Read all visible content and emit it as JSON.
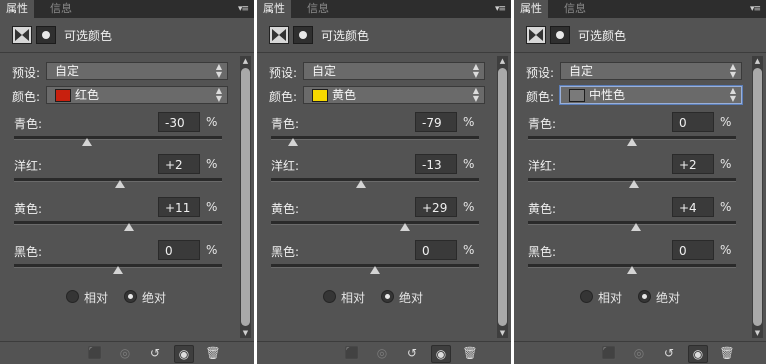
{
  "panels": [
    {
      "tabs": [
        "属性",
        "信息"
      ],
      "title": "可选颜色",
      "preset_label": "预设:",
      "preset_value": "自定",
      "color_label": "颜色:",
      "color_value": "红色",
      "color_swatch": "#c8200e",
      "sliders": [
        {
          "label": "青色:",
          "value": "-30",
          "unit": "%",
          "level": -30
        },
        {
          "label": "洋红:",
          "value": "+2",
          "unit": "%",
          "level": 2
        },
        {
          "label": "黄色:",
          "value": "+11",
          "unit": "%",
          "level": 11
        },
        {
          "label": "黑色:",
          "value": "0",
          "unit": "%",
          "level": 0
        }
      ],
      "radio_relative": "相对",
      "radio_absolute": "绝对",
      "mode_selected": "absolute"
    },
    {
      "tabs": [
        "属性",
        "信息"
      ],
      "title": "可选颜色",
      "preset_label": "预设:",
      "preset_value": "自定",
      "color_label": "颜色:",
      "color_value": "黄色",
      "color_swatch": "#f5d800",
      "sliders": [
        {
          "label": "青色:",
          "value": "-79",
          "unit": "%",
          "level": -79
        },
        {
          "label": "洋红:",
          "value": "-13",
          "unit": "%",
          "level": -13
        },
        {
          "label": "黄色:",
          "value": "+29",
          "unit": "%",
          "level": 29
        },
        {
          "label": "黑色:",
          "value": "0",
          "unit": "%",
          "level": 0
        }
      ],
      "radio_relative": "相对",
      "radio_absolute": "绝对",
      "mode_selected": "absolute"
    },
    {
      "tabs": [
        "属性",
        "信息"
      ],
      "title": "可选颜色",
      "preset_label": "预设:",
      "preset_value": "自定",
      "color_label": "颜色:",
      "color_value": "中性色",
      "color_swatch": "#7a7a7a",
      "sliders": [
        {
          "label": "青色:",
          "value": "0",
          "unit": "%",
          "level": 0
        },
        {
          "label": "洋红:",
          "value": "+2",
          "unit": "%",
          "level": 2
        },
        {
          "label": "黄色:",
          "value": "+4",
          "unit": "%",
          "level": 4
        },
        {
          "label": "黑色:",
          "value": "0",
          "unit": "%",
          "level": 0
        }
      ],
      "radio_relative": "相对",
      "radio_absolute": "绝对",
      "mode_selected": "absolute"
    }
  ],
  "icons": {
    "panel_menu": "panel-menu-icon",
    "header_adjustment": "selective-color-icon",
    "header_mask": "layer-mask-icon",
    "footer": [
      "clip-to-layer-icon",
      "view-previous-state-icon",
      "reset-icon",
      "visibility-eye-icon",
      "trash-icon"
    ]
  }
}
